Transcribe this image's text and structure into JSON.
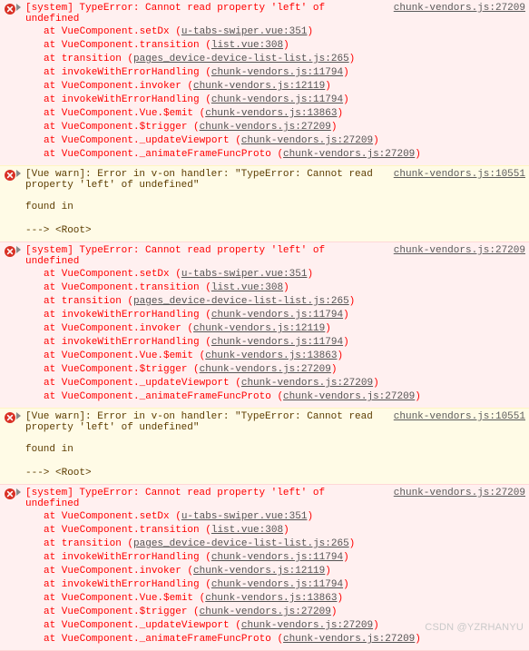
{
  "watermark": "CSDN @YZRHANYU",
  "messages": [
    {
      "type": "error",
      "title": "[system] TypeError: Cannot read property 'left' of undefined",
      "source": "chunk-vendors.js:27209",
      "stack": [
        {
          "at": "at VueComponent.setDx (",
          "link": "u-tabs-swiper.vue:351",
          "close": ")"
        },
        {
          "at": "at VueComponent.transition (",
          "link": "list.vue:308",
          "close": ")"
        },
        {
          "at": "at transition (",
          "link": "pages_device-device-list-list.js:265",
          "close": ")"
        },
        {
          "at": "at invokeWithErrorHandling (",
          "link": "chunk-vendors.js:11794",
          "close": ")"
        },
        {
          "at": "at VueComponent.invoker (",
          "link": "chunk-vendors.js:12119",
          "close": ")"
        },
        {
          "at": "at invokeWithErrorHandling (",
          "link": "chunk-vendors.js:11794",
          "close": ")"
        },
        {
          "at": "at VueComponent.Vue.$emit (",
          "link": "chunk-vendors.js:13863",
          "close": ")"
        },
        {
          "at": "at VueComponent.$trigger (",
          "link": "chunk-vendors.js:27209",
          "close": ")"
        },
        {
          "at": "at VueComponent._updateViewport (",
          "link": "chunk-vendors.js:27209",
          "close": ")"
        },
        {
          "at": "at VueComponent._animateFrameFuncProto (",
          "link": "chunk-vendors.js:27209",
          "close": ")"
        }
      ]
    },
    {
      "type": "warn",
      "title": "[Vue warn]: Error in v-on handler: \"TypeError: Cannot read property 'left' of undefined\"",
      "source": "chunk-vendors.js:10551",
      "body": {
        "found": "found in",
        "root": "---> <Root>"
      }
    },
    {
      "type": "error",
      "title": "[system] TypeError: Cannot read property 'left' of undefined",
      "source": "chunk-vendors.js:27209",
      "stack": [
        {
          "at": "at VueComponent.setDx (",
          "link": "u-tabs-swiper.vue:351",
          "close": ")"
        },
        {
          "at": "at VueComponent.transition (",
          "link": "list.vue:308",
          "close": ")"
        },
        {
          "at": "at transition (",
          "link": "pages_device-device-list-list.js:265",
          "close": ")"
        },
        {
          "at": "at invokeWithErrorHandling (",
          "link": "chunk-vendors.js:11794",
          "close": ")"
        },
        {
          "at": "at VueComponent.invoker (",
          "link": "chunk-vendors.js:12119",
          "close": ")"
        },
        {
          "at": "at invokeWithErrorHandling (",
          "link": "chunk-vendors.js:11794",
          "close": ")"
        },
        {
          "at": "at VueComponent.Vue.$emit (",
          "link": "chunk-vendors.js:13863",
          "close": ")"
        },
        {
          "at": "at VueComponent.$trigger (",
          "link": "chunk-vendors.js:27209",
          "close": ")"
        },
        {
          "at": "at VueComponent._updateViewport (",
          "link": "chunk-vendors.js:27209",
          "close": ")"
        },
        {
          "at": "at VueComponent._animateFrameFuncProto (",
          "link": "chunk-vendors.js:27209",
          "close": ")"
        }
      ]
    },
    {
      "type": "warn",
      "title": "[Vue warn]: Error in v-on handler: \"TypeError: Cannot read property 'left' of undefined\"",
      "source": "chunk-vendors.js:10551",
      "body": {
        "found": "found in",
        "root": "---> <Root>"
      }
    },
    {
      "type": "error",
      "title": "[system] TypeError: Cannot read property 'left' of undefined",
      "source": "chunk-vendors.js:27209",
      "stack": [
        {
          "at": "at VueComponent.setDx (",
          "link": "u-tabs-swiper.vue:351",
          "close": ")"
        },
        {
          "at": "at VueComponent.transition (",
          "link": "list.vue:308",
          "close": ")"
        },
        {
          "at": "at transition (",
          "link": "pages_device-device-list-list.js:265",
          "close": ")"
        },
        {
          "at": "at invokeWithErrorHandling (",
          "link": "chunk-vendors.js:11794",
          "close": ")"
        },
        {
          "at": "at VueComponent.invoker (",
          "link": "chunk-vendors.js:12119",
          "close": ")"
        },
        {
          "at": "at invokeWithErrorHandling (",
          "link": "chunk-vendors.js:11794",
          "close": ")"
        },
        {
          "at": "at VueComponent.Vue.$emit (",
          "link": "chunk-vendors.js:13863",
          "close": ")"
        },
        {
          "at": "at VueComponent.$trigger (",
          "link": "chunk-vendors.js:27209",
          "close": ")"
        },
        {
          "at": "at VueComponent._updateViewport (",
          "link": "chunk-vendors.js:27209",
          "close": ")"
        },
        {
          "at": "at VueComponent._animateFrameFuncProto (",
          "link": "chunk-vendors.js:27209",
          "close": ")"
        }
      ]
    }
  ]
}
